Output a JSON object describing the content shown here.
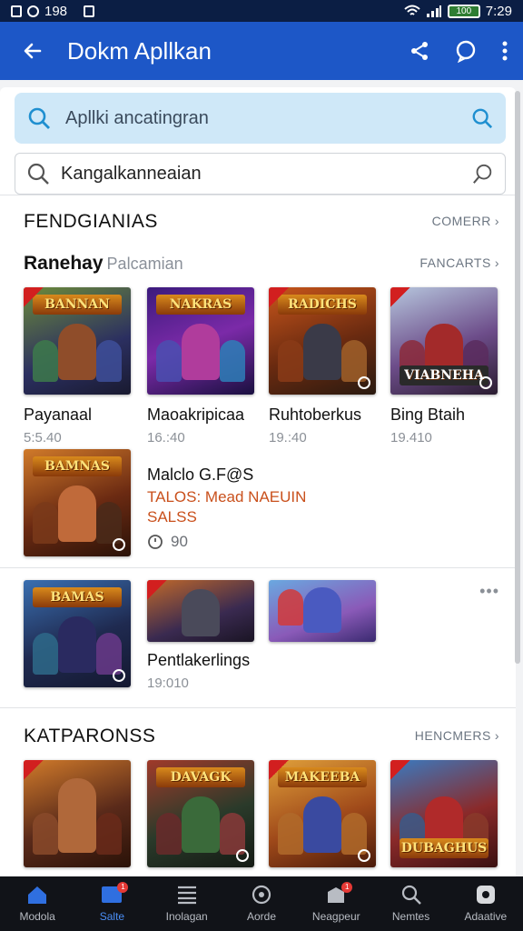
{
  "status_bar": {
    "left_text": "198",
    "time": "7:29",
    "battery": "100"
  },
  "app_bar": {
    "title": "Dokm Apllkan"
  },
  "search_primary": {
    "placeholder": "Apllki ancatingran"
  },
  "search_secondary": {
    "value": "Kangalkanneaian"
  },
  "section1": {
    "title": "FENDGIANIAS",
    "link": "COMERR",
    "subheader": {
      "title": "Ranehay",
      "muted": "Palcamian",
      "link": "FANCARTS"
    },
    "apps": [
      {
        "banner": "BANNAN",
        "name": "Payanaal",
        "meta": "5:5.40"
      },
      {
        "banner": "NAKRAS",
        "name": "Maoakripicaa",
        "meta": "16.:40"
      },
      {
        "banner": "RADICHS",
        "name": "Ruhtoberkus",
        "meta": "19.:40"
      },
      {
        "banner": "VIABNEHA",
        "name": "Bing Btaih",
        "meta": "19.410"
      }
    ],
    "featured": {
      "banner": "BAMNAS",
      "name": "Malclo G.F@S",
      "tag": "TALOS: Mead NAEUIN",
      "price": "SALSS",
      "rating": "90"
    },
    "row2": [
      {
        "banner": "BAMAS"
      },
      {
        "banner": "",
        "name": "Pentlakerlings",
        "meta": "19:010"
      },
      {
        "banner": ""
      }
    ]
  },
  "section2": {
    "title": "KATPARONSS",
    "link": "HENCMERS",
    "apps": [
      {
        "banner": ""
      },
      {
        "banner": "DAVAGK"
      },
      {
        "banner": "MAKEEBA"
      },
      {
        "banner": "DUBAGHUS"
      }
    ]
  },
  "bottom_nav": [
    {
      "label": "Modola",
      "icon": "home-icon",
      "active": false
    },
    {
      "label": "Salte",
      "icon": "store-icon",
      "active": true,
      "badge": "1"
    },
    {
      "label": "Inolagan",
      "icon": "list-icon",
      "active": false
    },
    {
      "label": "Aorde",
      "icon": "circle-icon",
      "active": false
    },
    {
      "label": "Neagpeur",
      "icon": "inbox-icon",
      "active": false,
      "badge": "1"
    },
    {
      "label": "Nemtes",
      "icon": "search-icon",
      "active": false
    },
    {
      "label": "Adaative",
      "icon": "app-icon",
      "active": false
    }
  ],
  "colors": {
    "app_bar": "#1d57c7",
    "accent_tag": "#c9501c",
    "nav_active": "#4a8ef5"
  }
}
